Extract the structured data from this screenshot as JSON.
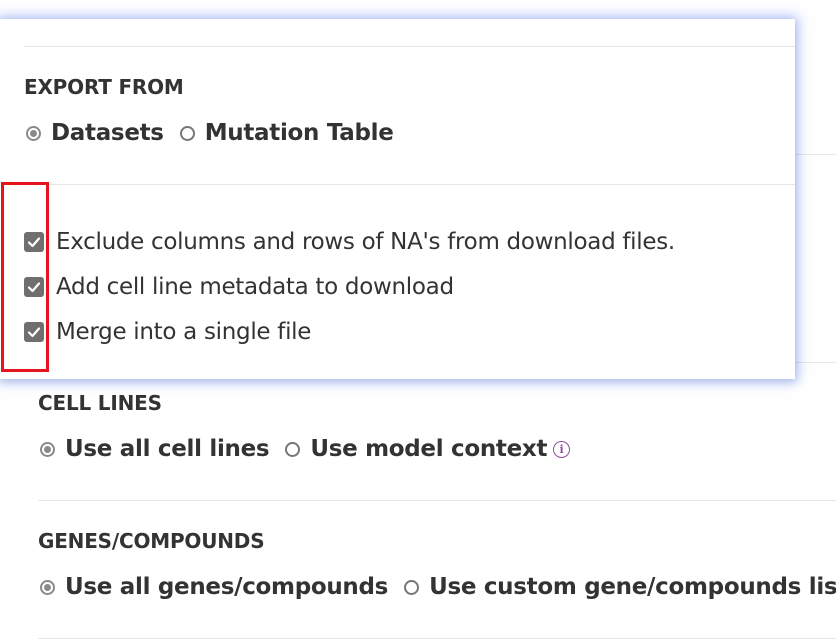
{
  "background_form": {
    "cell_lines": {
      "title": "CELL LINES",
      "options": [
        {
          "label": "Use all cell lines",
          "selected": true
        },
        {
          "label": "Use model context",
          "selected": false
        }
      ],
      "info_icon": "info-icon"
    },
    "genes_compounds": {
      "title": "GENES/COMPOUNDS",
      "options": [
        {
          "label": "Use all genes/compounds",
          "selected": true
        },
        {
          "label": "Use custom gene/compounds list",
          "selected": false
        }
      ],
      "info_icon": "info-icon"
    }
  },
  "popover": {
    "export_from": {
      "title": "EXPORT FROM",
      "options": [
        {
          "label": "Datasets",
          "selected": true
        },
        {
          "label": "Mutation Table",
          "selected": false
        }
      ]
    },
    "checkboxes": [
      {
        "label": "Exclude columns and rows of NA's from download files.",
        "checked": true
      },
      {
        "label": "Add cell line metadata to download",
        "checked": true
      },
      {
        "label": "Merge into a single file",
        "checked": true
      }
    ]
  },
  "colors": {
    "highlight": "#e8141b",
    "info": "#8e4d9b",
    "checkbox_fill": "#6f6f6f",
    "popover_glow": "#7896ff"
  }
}
